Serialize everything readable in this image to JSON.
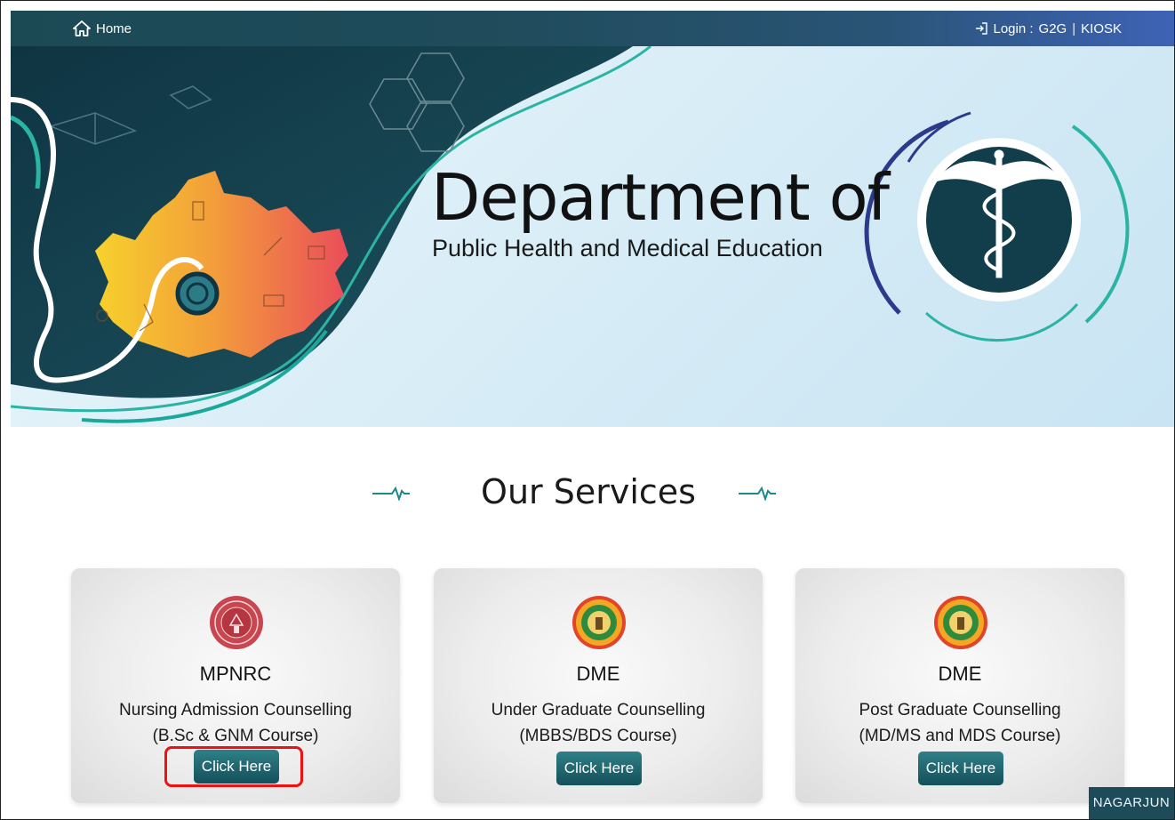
{
  "nav": {
    "home_label": "Home",
    "login_prefix": "Login :",
    "login_g2g": "G2G",
    "separator": "|",
    "login_kiosk": "KIOSK"
  },
  "hero": {
    "title": "Department of",
    "subtitle": "Public Health and Medical Education"
  },
  "services": {
    "heading": "Our Services",
    "cards": [
      {
        "name": "MPNRC",
        "line1": "Nursing Admission Counselling",
        "line2": "(B.Sc & GNM Course)",
        "button": "Click Here",
        "logo": "mpnrc-seal-icon"
      },
      {
        "name": "DME",
        "line1": "Under Graduate Counselling",
        "line2": "(MBBS/BDS Course)",
        "button": "Click Here",
        "logo": "mp-emblem-icon"
      },
      {
        "name": "DME",
        "line1": "Post Graduate Counselling",
        "line2": "(MD/MS and MDS Course)",
        "button": "Click Here",
        "logo": "mp-emblem-icon"
      }
    ]
  },
  "footer_badge": "NAGARJUN",
  "colors": {
    "nav_start": "#1b4a55",
    "nav_end": "#3e63b6",
    "button": "#14505a",
    "highlight": "#e11111",
    "teal_accent": "#1aa89a"
  }
}
